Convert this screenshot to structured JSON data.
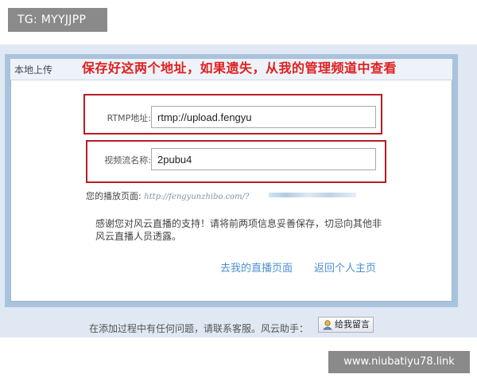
{
  "overlay": {
    "tg_label": "TG: MYYJJPP",
    "site_label": "www.niubatiyu78.link"
  },
  "header": {
    "tab_label": "本地上传",
    "annotation": "保存好这两个地址，如果遗失，从我的管理频道中查看"
  },
  "form": {
    "rtmp_label": "RTMP地址:",
    "rtmp_value": "rtmp://upload.fengyu",
    "stream_label": "视频流名称:",
    "stream_value": "2pubu4",
    "playback_label": "您的播放页面:",
    "playback_url": "http://fengyunzhibo.com/?"
  },
  "notice": {
    "text": "感谢您对风云直播的支持！请将前两项信息妥善保存，切忌向其他非风云直播人员透露。"
  },
  "links": {
    "live_page": "去我的直播页面",
    "home_page": "返回个人主页"
  },
  "footer": {
    "help_text": "在添加过程中有任何问题，请联系客服。风云助手：",
    "message_button": "给我留言"
  },
  "colors": {
    "annotation_red": "#e02020",
    "highlight_border": "#b81c24",
    "link_blue": "#4f8fcf",
    "frame_blue": "#a9c3dc"
  }
}
